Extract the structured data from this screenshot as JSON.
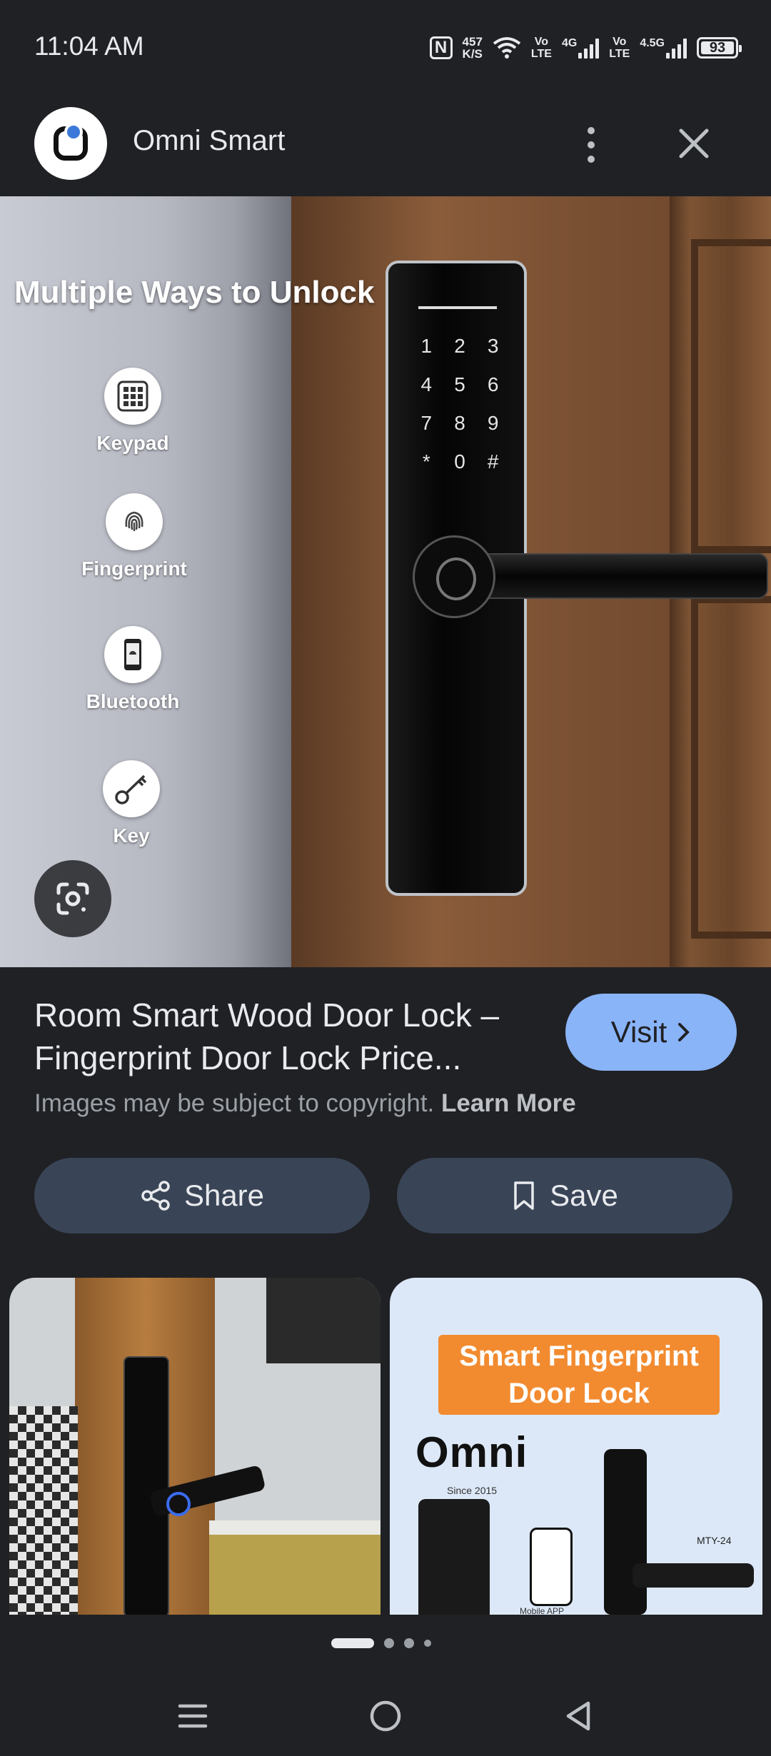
{
  "status_bar": {
    "time": "11:04 AM",
    "nfc_icon": "N",
    "net_speed_value": "457",
    "net_speed_unit": "K/S",
    "volte1_top": "Vo",
    "volte1_bottom": "LTE",
    "network_4g": "4G",
    "volte2_top": "Vo",
    "volte2_bottom": "LTE",
    "network_45g": "4.5G",
    "battery": "93"
  },
  "header": {
    "site_name": "Omni Smart",
    "more_icon": "more-vert-icon",
    "close_icon": "close-icon"
  },
  "main_image": {
    "headline": "Multiple  Ways to Unlock",
    "unlock_methods": [
      {
        "label": "Keypad",
        "icon": "keypad-icon"
      },
      {
        "label": "Fingerprint",
        "icon": "fingerprint-icon"
      },
      {
        "label": "Bluetooth",
        "icon": "bluetooth-phone-icon"
      },
      {
        "label": "Key",
        "icon": "key-icon"
      }
    ],
    "keypad_keys": [
      "1",
      "2",
      "3",
      "4",
      "5",
      "6",
      "7",
      "8",
      "9",
      "*",
      "0",
      "#"
    ],
    "lens_icon": "google-lens-icon"
  },
  "result": {
    "title": "Room Smart Wood Door Lock – Fingerprint Door Lock Price...",
    "visit_label": "Visit",
    "copyright_text": "Images may be subject to copyright.",
    "learn_more": "Learn More"
  },
  "actions": {
    "share_label": "Share",
    "save_label": "Save"
  },
  "related": {
    "item2_banner_line1": "Smart Fingerprint",
    "item2_banner_line2": "Door Lock",
    "item2_brand": "Omni",
    "item2_since": "Since 2015",
    "item2_app_label": "Mobile APP",
    "item2_model": "MTY-24"
  },
  "pager": {
    "pages": 4,
    "active": 1
  },
  "colors": {
    "background": "#202124",
    "accent": "#8ab4f8",
    "action_button": "#394457"
  }
}
